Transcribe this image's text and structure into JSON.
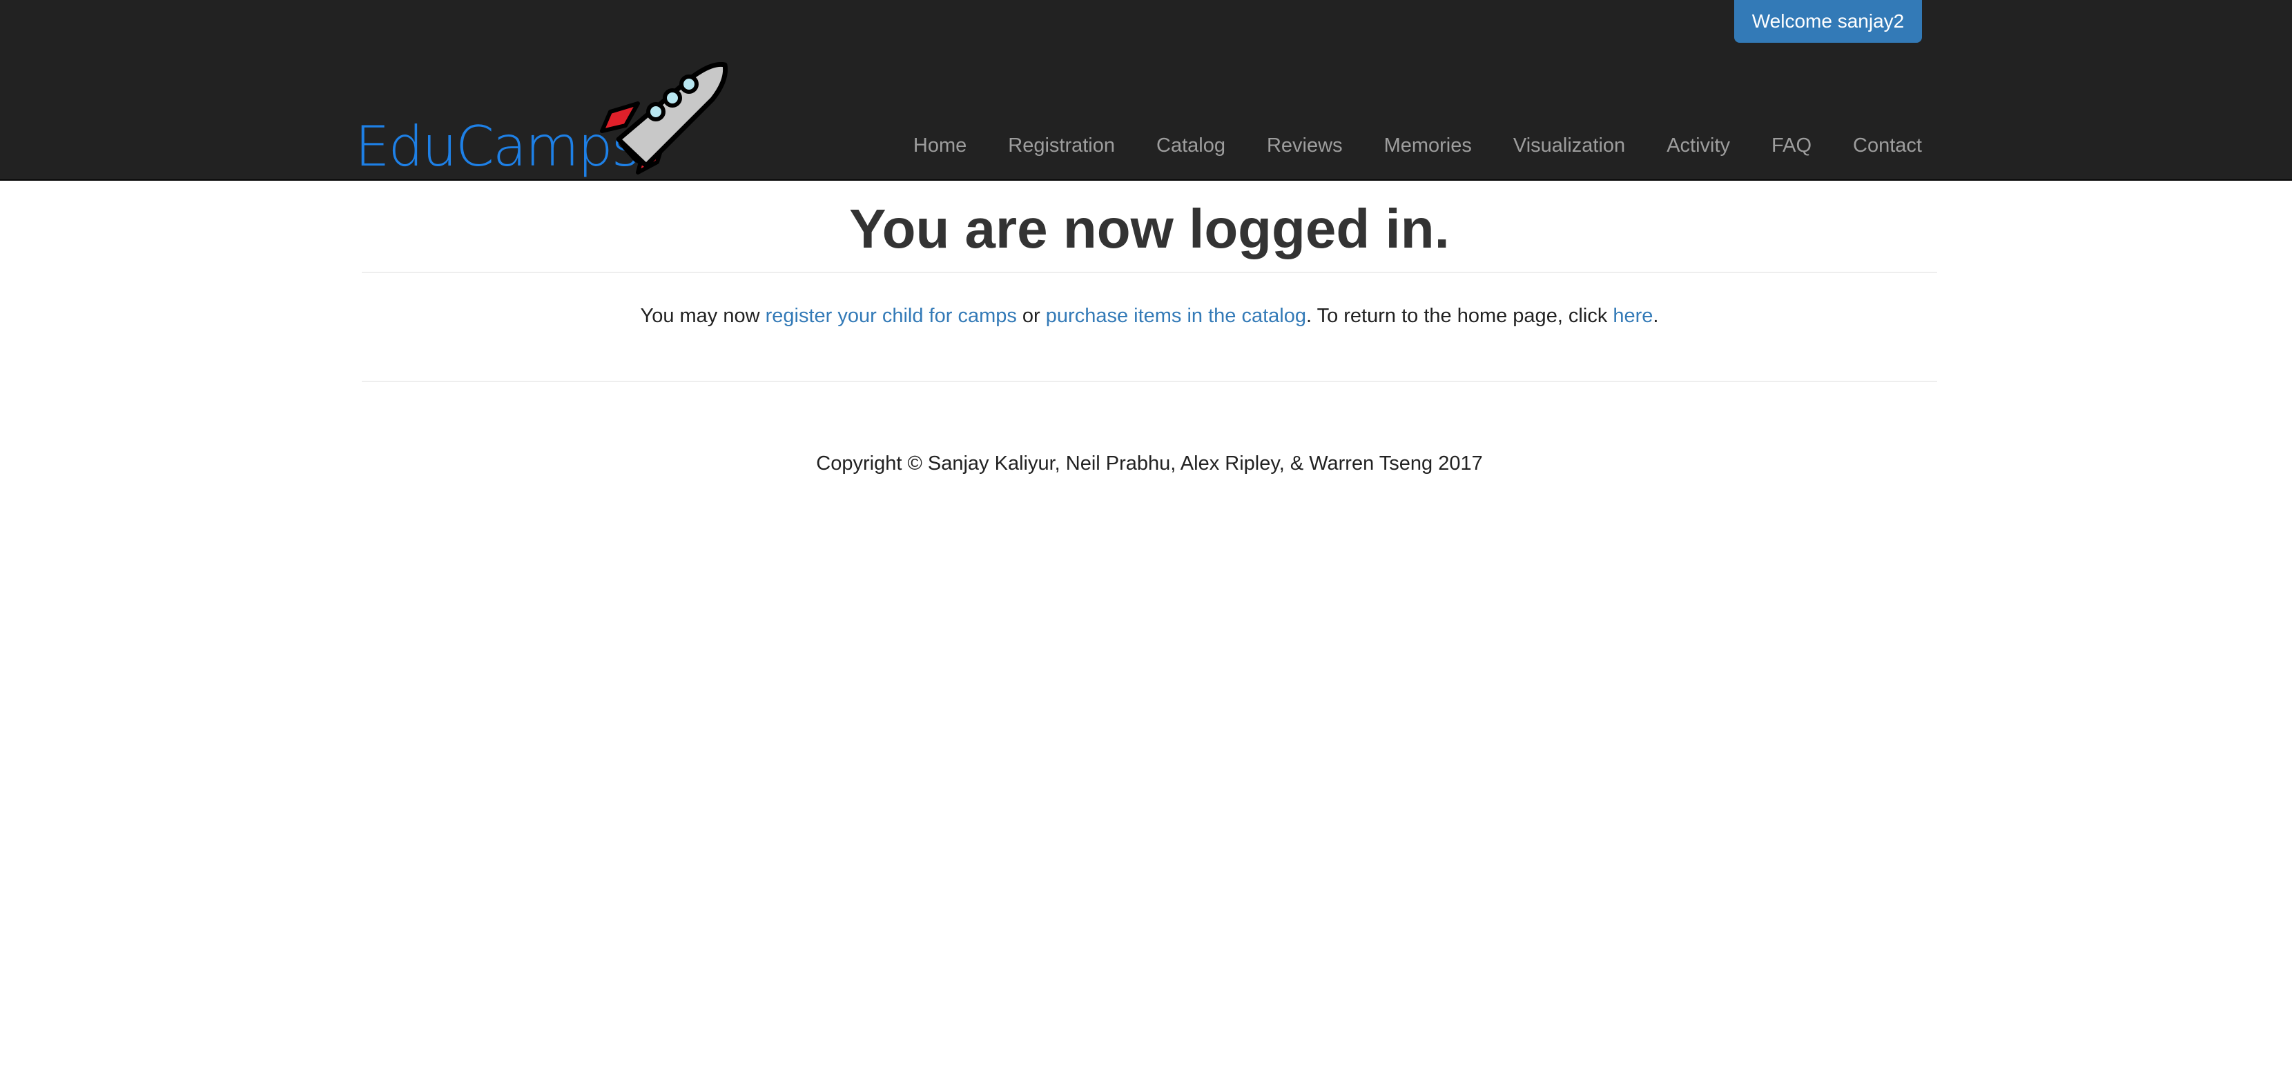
{
  "header": {
    "welcome_button": "Welcome sanjay2",
    "brand_text": "EduCamps",
    "nav": [
      "Home",
      "Registration",
      "Catalog",
      "Reviews",
      "Memories",
      "Visualization",
      "Activity",
      "FAQ",
      "Contact"
    ]
  },
  "main": {
    "title": "You are now logged in.",
    "intro": {
      "prefix": "You may now ",
      "link_register": "register your child for camps",
      "middle": " or ",
      "link_catalog": "purchase items in the catalog",
      "suffix_before_here": ". To return to the home page, click ",
      "link_here": "here",
      "end": "."
    }
  },
  "footer": {
    "copyright": "Copyright © Sanjay Kaliyur, Neil Prabhu, Alex Ripley, & Warren Tseng 2017"
  },
  "colors": {
    "navbar_bg": "#222222",
    "brand_blue": "#1e80e6",
    "link_blue": "#337ab7",
    "nav_text": "#9d9d9d",
    "rocket_red": "#e0202a",
    "rocket_body": "#c8c8c8"
  },
  "icons": {
    "brand_rocket": "rocket-icon"
  }
}
